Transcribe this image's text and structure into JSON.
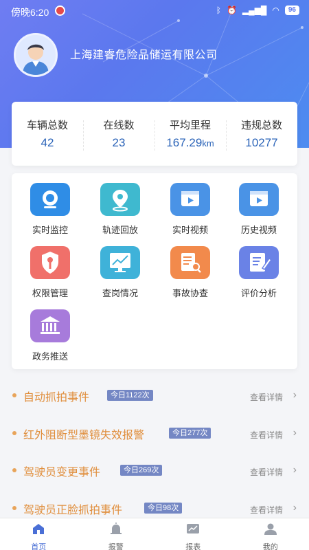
{
  "status": {
    "time": "傍晚6:20",
    "battery": "96"
  },
  "header": {
    "company": "上海建睿危险品储运有限公司"
  },
  "stats": [
    {
      "label": "车辆总数",
      "value": "42",
      "unit": ""
    },
    {
      "label": "在线数",
      "value": "23",
      "unit": ""
    },
    {
      "label": "平均里程",
      "value": "167.29",
      "unit": "km"
    },
    {
      "label": "违规总数",
      "value": "10277",
      "unit": ""
    }
  ],
  "features": [
    {
      "label": "实时监控",
      "icon": "camera-icon",
      "color": "#2f8de6"
    },
    {
      "label": "轨迹回放",
      "icon": "location-pin-icon",
      "color": "#3fb9cf"
    },
    {
      "label": "实时视频",
      "icon": "video-icon",
      "color": "#4a93e6"
    },
    {
      "label": "历史视频",
      "icon": "video-icon",
      "color": "#4a93e6"
    },
    {
      "label": "权限管理",
      "icon": "key-shield-icon",
      "color": "#f0706a"
    },
    {
      "label": "查岗情况",
      "icon": "monitor-chart-icon",
      "color": "#3fb2d9"
    },
    {
      "label": "事故协查",
      "icon": "document-search-icon",
      "color": "#f28a4c"
    },
    {
      "label": "评价分析",
      "icon": "edit-document-icon",
      "color": "#6a82e6"
    },
    {
      "label": "政务推送",
      "icon": "government-building-icon",
      "color": "#a77bdb"
    }
  ],
  "events": [
    {
      "title": "自动抓拍事件",
      "badge": "今日1122次",
      "more": "查看详情"
    },
    {
      "title": "红外阻断型墨镜失效报警",
      "badge": "今日277次",
      "more": "查看详情"
    },
    {
      "title": "驾驶员变更事件",
      "badge": "今日269次",
      "more": "查看详情"
    },
    {
      "title": "驾驶员正脸抓拍事件",
      "badge": "今日98次",
      "more": "查看详情"
    }
  ],
  "tabs": [
    {
      "label": "首页",
      "icon": "home-icon"
    },
    {
      "label": "报警",
      "icon": "alarm-icon"
    },
    {
      "label": "报表",
      "icon": "report-icon"
    },
    {
      "label": "我的",
      "icon": "user-icon"
    }
  ]
}
